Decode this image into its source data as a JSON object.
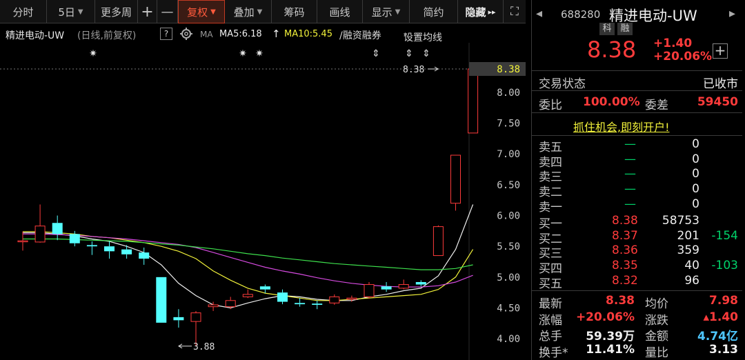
{
  "toolbar": {
    "items": [
      "分时",
      "5日",
      "更多周",
      "+",
      "—",
      "复权",
      "叠加",
      "筹码",
      "画线",
      "显示",
      "简约",
      "隐藏"
    ],
    "dropdown_arrow": "▼",
    "hide_arrow": "▸▸",
    "fullscreen_icon": "⛶"
  },
  "info": {
    "title": "精进电动-UW",
    "period": "(日线,前复权)",
    "help": "?",
    "gear_icon": "gear-icon",
    "ma_tag": "MA",
    "ma5": "MA5:6.18",
    "ma5_arrow": "↑",
    "ma10": "MA10:5.45",
    "margin": "/融资融券",
    "set_ma": "设置均线",
    "set_ma_arrow": "▾"
  },
  "chart_data": {
    "type": "candlestick",
    "y_ticks": [
      "8.38",
      "8.00",
      "7.50",
      "7.00",
      "6.50",
      "6.00",
      "5.50",
      "5.00",
      "4.50",
      "4.00"
    ],
    "current_price_label": "8.38",
    "high_label": "8.38",
    "low_label": "3.88",
    "ylim": [
      3.88,
      8.38
    ],
    "grid": false,
    "candles": [
      {
        "o": 5.59,
        "c": 5.59,
        "h": 5.74,
        "l": 5.43
      },
      {
        "o": 5.57,
        "c": 5.83,
        "h": 6.18,
        "l": 5.56
      },
      {
        "o": 5.88,
        "c": 5.7,
        "h": 6.0,
        "l": 5.6
      },
      {
        "o": 5.7,
        "c": 5.55,
        "h": 5.75,
        "l": 5.5
      },
      {
        "o": 5.52,
        "c": 5.5,
        "h": 5.58,
        "l": 5.36
      },
      {
        "o": 5.5,
        "c": 5.42,
        "h": 5.58,
        "l": 5.3
      },
      {
        "o": 5.45,
        "c": 5.37,
        "h": 5.52,
        "l": 5.3
      },
      {
        "o": 5.4,
        "c": 5.3,
        "h": 5.48,
        "l": 5.2
      },
      {
        "o": 5.0,
        "c": 4.26,
        "h": 5.0,
        "l": 4.26
      },
      {
        "o": 4.35,
        "c": 4.3,
        "h": 4.48,
        "l": 4.18
      },
      {
        "o": 4.28,
        "c": 4.42,
        "h": 4.45,
        "l": 3.88
      },
      {
        "o": 4.52,
        "c": 4.55,
        "h": 4.6,
        "l": 4.45
      },
      {
        "o": 4.52,
        "c": 4.62,
        "h": 4.68,
        "l": 4.48
      },
      {
        "o": 4.68,
        "c": 4.72,
        "h": 4.8,
        "l": 4.66
      },
      {
        "o": 4.85,
        "c": 4.8,
        "h": 4.88,
        "l": 4.74
      },
      {
        "o": 4.75,
        "c": 4.6,
        "h": 4.8,
        "l": 4.56
      },
      {
        "o": 4.58,
        "c": 4.56,
        "h": 4.66,
        "l": 4.52
      },
      {
        "o": 4.57,
        "c": 4.55,
        "h": 4.62,
        "l": 4.48
      },
      {
        "o": 4.58,
        "c": 4.68,
        "h": 4.72,
        "l": 4.55
      },
      {
        "o": 4.64,
        "c": 4.66,
        "h": 4.7,
        "l": 4.6
      },
      {
        "o": 4.68,
        "c": 4.88,
        "h": 4.92,
        "l": 4.65
      },
      {
        "o": 4.85,
        "c": 4.8,
        "h": 4.92,
        "l": 4.76
      },
      {
        "o": 4.82,
        "c": 4.88,
        "h": 4.96,
        "l": 4.8
      },
      {
        "o": 4.92,
        "c": 4.88,
        "h": 4.95,
        "l": 4.85
      },
      {
        "o": 5.35,
        "c": 5.82,
        "h": 5.84,
        "l": 5.35
      },
      {
        "o": 6.2,
        "c": 6.98,
        "h": 6.98,
        "l": 6.08
      },
      {
        "o": 7.34,
        "c": 8.38,
        "h": 8.38,
        "l": 7.34
      }
    ],
    "ma_lines": [
      {
        "name": "MA5",
        "color": "#f0f0f0",
        "values": [
          5.72,
          5.72,
          5.7,
          5.67,
          5.62,
          5.58,
          5.5,
          5.4,
          5.2,
          4.9,
          4.7,
          4.55,
          4.5,
          4.58,
          4.65,
          4.7,
          4.68,
          4.64,
          4.62,
          4.62,
          4.68,
          4.72,
          4.78,
          4.82,
          5.02,
          5.45,
          6.18
        ]
      },
      {
        "name": "MA10",
        "color": "#f2f23a",
        "values": [
          5.74,
          5.74,
          5.72,
          5.7,
          5.66,
          5.64,
          5.6,
          5.56,
          5.5,
          5.42,
          5.3,
          5.1,
          4.95,
          4.82,
          4.74,
          4.7,
          4.66,
          4.62,
          4.62,
          4.64,
          4.66,
          4.68,
          4.7,
          4.72,
          4.8,
          5.0,
          5.45
        ]
      },
      {
        "name": "MA20",
        "color": "#d64be0",
        "values": [
          5.7,
          5.7,
          5.69,
          5.68,
          5.66,
          5.64,
          5.62,
          5.59,
          5.56,
          5.53,
          5.48,
          5.4,
          5.32,
          5.24,
          5.16,
          5.1,
          5.05,
          4.99,
          4.94,
          4.9,
          4.87,
          4.85,
          4.84,
          4.84,
          4.86,
          4.92,
          5.03
        ]
      },
      {
        "name": "MA30",
        "color": "#3ee14d",
        "values": [
          5.62,
          5.62,
          5.62,
          5.61,
          5.6,
          5.59,
          5.58,
          5.56,
          5.54,
          5.52,
          5.49,
          5.46,
          5.42,
          5.38,
          5.35,
          5.31,
          5.28,
          5.25,
          5.22,
          5.2,
          5.18,
          5.16,
          5.14,
          5.12,
          5.12,
          5.14,
          5.2
        ]
      }
    ],
    "markers": [
      "✷",
      "✷",
      "✷",
      "⇕",
      "⇕",
      "⇕"
    ]
  },
  "quote": {
    "code": "688280",
    "name": "精进电动-UW",
    "prev_arrow": "◂",
    "next_arrow": "▸",
    "tags": [
      "科",
      "融"
    ],
    "price": "8.38",
    "change": "+1.40",
    "change_pct": "+20.06%",
    "plus_button": "+",
    "trade_status_label": "交易状态",
    "trade_status": "已收市",
    "weibi_label": "委比",
    "weibi": "100.00%",
    "weicha_label": "委差",
    "weicha": "59450",
    "ad": "抓住机会,即刻开户!",
    "sells": [
      {
        "label": "卖五",
        "price": "—",
        "vol": "0"
      },
      {
        "label": "卖四",
        "price": "—",
        "vol": "0"
      },
      {
        "label": "卖三",
        "price": "—",
        "vol": "0"
      },
      {
        "label": "卖二",
        "price": "—",
        "vol": "0"
      },
      {
        "label": "卖一",
        "price": "—",
        "vol": "0"
      }
    ],
    "buys": [
      {
        "label": "买一",
        "price": "8.38",
        "vol": "58753",
        "chg": ""
      },
      {
        "label": "买二",
        "price": "8.37",
        "vol": "201",
        "chg": "-154"
      },
      {
        "label": "买三",
        "price": "8.36",
        "vol": "359",
        "chg": ""
      },
      {
        "label": "买四",
        "price": "8.35",
        "vol": "40",
        "chg": "-103"
      },
      {
        "label": "买五",
        "price": "8.32",
        "vol": "96",
        "chg": ""
      }
    ],
    "stats": [
      {
        "l1": "最新",
        "v1": "8.38",
        "l2": "均价",
        "v2": "7.98"
      },
      {
        "l1": "涨幅",
        "v1": "+20.06%",
        "l2": "涨跌",
        "v2": "▴1.40"
      },
      {
        "l1": "总手",
        "v1": "59.39万",
        "l2": "金额",
        "v2": "4.74亿"
      },
      {
        "l1": "换手*",
        "v1": "11.41%",
        "l2": "量比",
        "v2": "3.13"
      }
    ]
  }
}
